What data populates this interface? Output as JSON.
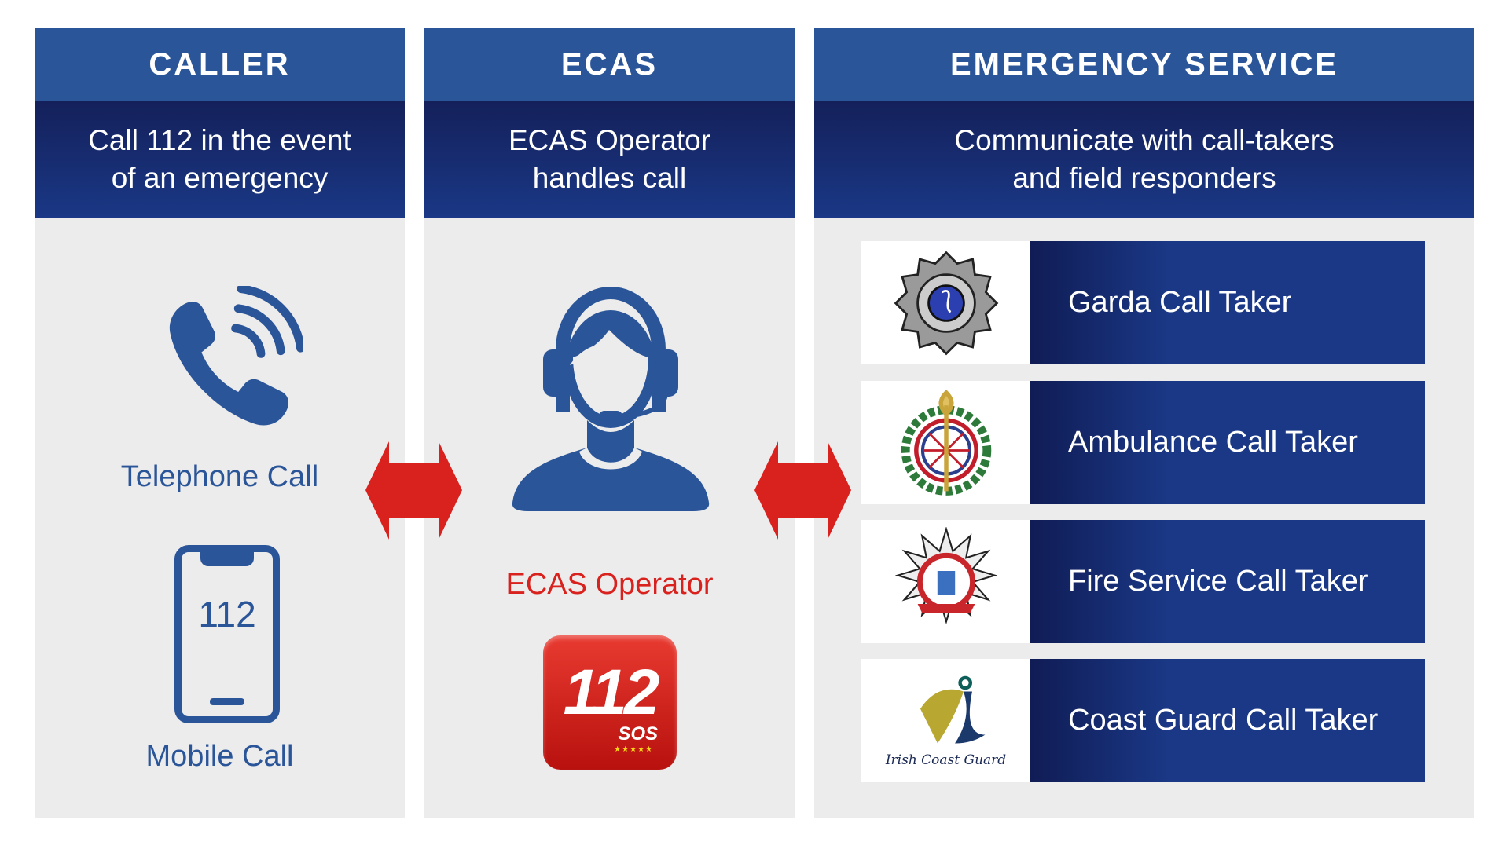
{
  "columns": [
    {
      "title": "CALLER",
      "subtitle": [
        "Call 112 in the event",
        "of an emergency"
      ]
    },
    {
      "title": "ECAS",
      "subtitle": [
        "ECAS Operator",
        "handles call"
      ]
    },
    {
      "title": "EMERGENCY SERVICE",
      "subtitle": [
        "Communicate with call-takers",
        "and field responders"
      ]
    }
  ],
  "caller": {
    "telephone_label": "Telephone Call",
    "mobile_label": "Mobile Call",
    "mobile_screen_text": "112"
  },
  "ecas": {
    "operator_label": "ECAS Operator",
    "logo_number": "112",
    "logo_sub": "SOS"
  },
  "services": [
    {
      "label": "Garda Call Taker",
      "icon": "garda-crest"
    },
    {
      "label": "Ambulance Call Taker",
      "icon": "ambulance-crest"
    },
    {
      "label": "Fire Service Call Taker",
      "icon": "fire-service-crest"
    },
    {
      "label": "Coast Guard Call Taker",
      "icon": "coast-guard-logo",
      "logo_text": "Irish Coast Guard"
    }
  ],
  "colors": {
    "header": "#2b5599",
    "subheader": "#1a3886",
    "panel": "#ececec",
    "arrow": "#d9211e",
    "accent_red": "#d9211e"
  }
}
